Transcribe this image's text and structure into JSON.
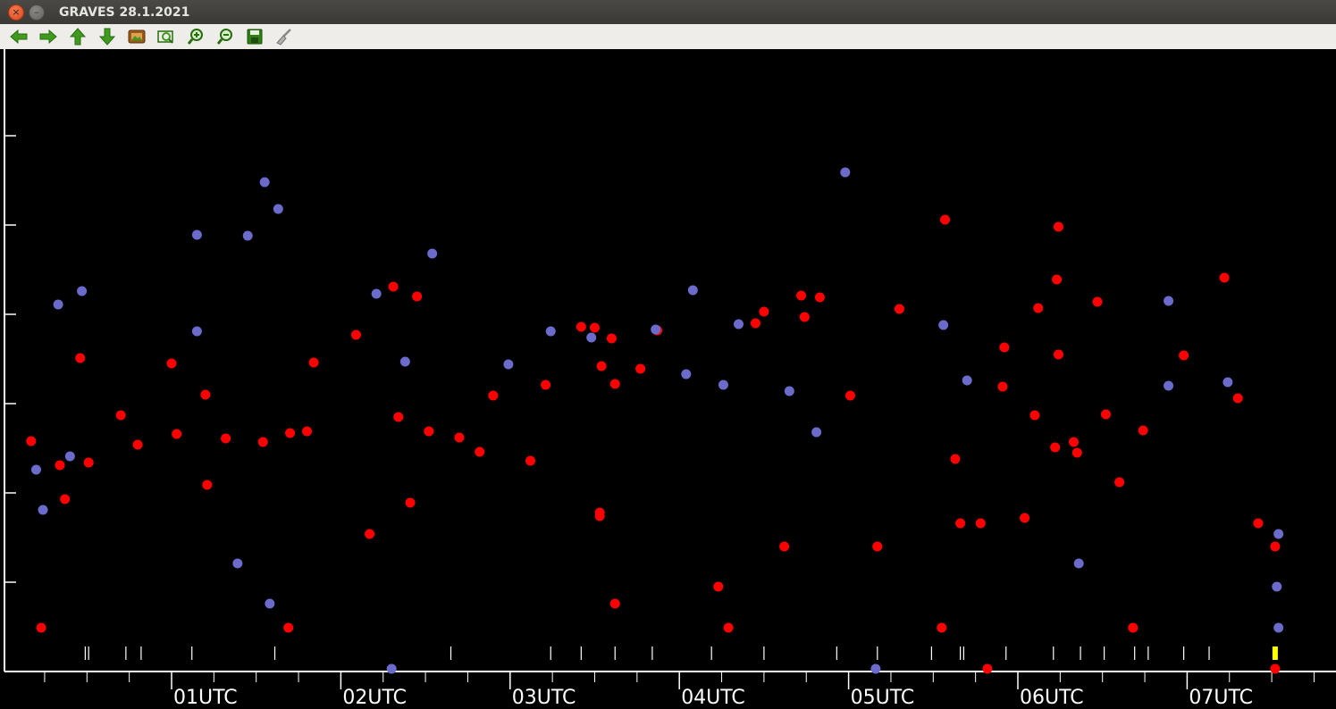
{
  "window": {
    "title": "GRAVES 28.1.2021"
  },
  "toolbar": {
    "items": [
      {
        "name": "back-arrow-icon",
        "kind": "arrow-left"
      },
      {
        "name": "forward-arrow-icon",
        "kind": "arrow-right"
      },
      {
        "name": "up-arrow-icon",
        "kind": "arrow-up"
      },
      {
        "name": "down-arrow-icon",
        "kind": "arrow-down"
      },
      {
        "name": "image-icon",
        "kind": "image"
      },
      {
        "name": "zoom-fit-icon",
        "kind": "zoom-fit"
      },
      {
        "name": "zoom-in-icon",
        "kind": "zoom-in"
      },
      {
        "name": "zoom-out-icon",
        "kind": "zoom-out"
      },
      {
        "name": "save-icon",
        "kind": "save"
      },
      {
        "name": "clear-brush-icon",
        "kind": "brush"
      }
    ]
  },
  "colors": {
    "red_series": "#ff0000",
    "blue_series": "#6b6bcc",
    "marker_highlight": "#ffff00",
    "axis": "#ffffff"
  },
  "chart_data": {
    "type": "scatter",
    "xlabel": "",
    "ylabel": "",
    "x_unit": "hour UTC",
    "xlim": [
      -0.98,
      7.83
    ],
    "ylim": [
      0,
      7
    ],
    "x_ticks": [
      {
        "x": 0,
        "label": "01UTC"
      },
      {
        "x": 1,
        "label": "02UTC"
      },
      {
        "x": 2,
        "label": "03UTC"
      },
      {
        "x": 3,
        "label": "04UTC"
      },
      {
        "x": 4,
        "label": "05UTC"
      },
      {
        "x": 5,
        "label": "06UTC"
      },
      {
        "x": 6,
        "label": "07UTC"
      }
    ],
    "minor_x_ticks": [
      -0.75,
      -0.5,
      -0.25,
      0.25,
      0.5,
      0.75,
      1.25,
      1.5,
      1.75,
      2.25,
      2.5,
      2.75,
      3.25,
      3.5,
      3.75,
      4.25,
      4.5,
      4.75,
      5.25,
      5.5,
      5.75,
      6.25,
      6.5,
      6.75
    ],
    "y_ticks": [
      1,
      2,
      3,
      4,
      5,
      6
    ],
    "event_marks": [
      -0.51,
      -0.49,
      -0.27,
      -0.18,
      0.12,
      0.61,
      1.65,
      2.24,
      2.42,
      2.62,
      2.84,
      3.19,
      3.5,
      3.93,
      4.17,
      4.49,
      4.66,
      4.68,
      4.93,
      5.21,
      5.37,
      5.51,
      5.69,
      5.77,
      5.98,
      6.13
    ],
    "highlight_mark": 6.52,
    "series": [
      {
        "name": "",
        "color": "#ff0000",
        "points": [
          [
            -0.83,
            2.58
          ],
          [
            -0.77,
            0.49
          ],
          [
            -0.66,
            2.31
          ],
          [
            -0.63,
            1.93
          ],
          [
            -0.54,
            3.51
          ],
          [
            -0.49,
            2.34
          ],
          [
            -0.3,
            2.87
          ],
          [
            -0.2,
            2.54
          ],
          [
            0.0,
            3.45
          ],
          [
            0.03,
            2.66
          ],
          [
            0.2,
            3.1
          ],
          [
            0.21,
            2.09
          ],
          [
            0.32,
            2.61
          ],
          [
            0.54,
            2.57
          ],
          [
            0.7,
            2.67
          ],
          [
            0.69,
            0.49
          ],
          [
            0.8,
            2.69
          ],
          [
            0.84,
            3.46
          ],
          [
            1.09,
            3.77
          ],
          [
            1.17,
            1.54
          ],
          [
            1.31,
            4.31
          ],
          [
            1.34,
            2.85
          ],
          [
            1.41,
            1.89
          ],
          [
            1.45,
            4.2
          ],
          [
            1.52,
            2.69
          ],
          [
            1.7,
            2.62
          ],
          [
            1.82,
            2.46
          ],
          [
            1.9,
            3.09
          ],
          [
            2.12,
            2.36
          ],
          [
            2.21,
            3.21
          ],
          [
            2.42,
            3.86
          ],
          [
            2.5,
            3.85
          ],
          [
            2.53,
            1.74
          ],
          [
            2.53,
            1.78
          ],
          [
            2.54,
            3.42
          ],
          [
            2.6,
            3.73
          ],
          [
            2.62,
            3.22
          ],
          [
            2.62,
            0.76
          ],
          [
            2.77,
            3.39
          ],
          [
            2.87,
            3.82
          ],
          [
            3.23,
            0.95
          ],
          [
            3.29,
            0.49
          ],
          [
            3.45,
            3.9
          ],
          [
            3.5,
            4.03
          ],
          [
            3.62,
            1.4
          ],
          [
            3.72,
            4.21
          ],
          [
            3.74,
            3.97
          ],
          [
            3.83,
            4.19
          ],
          [
            4.01,
            3.09
          ],
          [
            4.17,
            1.4
          ],
          [
            4.3,
            4.06
          ],
          [
            4.55,
            0.49
          ],
          [
            4.57,
            5.06
          ],
          [
            4.63,
            2.38
          ],
          [
            4.66,
            1.66
          ],
          [
            4.78,
            1.66
          ],
          [
            4.82,
            0.03
          ],
          [
            4.92,
            3.63
          ],
          [
            4.91,
            3.19
          ],
          [
            5.04,
            1.72
          ],
          [
            5.1,
            2.87
          ],
          [
            5.12,
            4.07
          ],
          [
            5.22,
            2.51
          ],
          [
            5.23,
            4.39
          ],
          [
            5.24,
            3.55
          ],
          [
            5.24,
            4.98
          ],
          [
            5.33,
            2.57
          ],
          [
            5.35,
            2.45
          ],
          [
            5.47,
            4.14
          ],
          [
            5.52,
            2.88
          ],
          [
            5.6,
            2.12
          ],
          [
            5.68,
            0.49
          ],
          [
            5.74,
            2.7
          ],
          [
            5.98,
            3.54
          ],
          [
            6.22,
            4.41
          ],
          [
            6.3,
            3.06
          ],
          [
            6.42,
            1.66
          ],
          [
            6.52,
            1.4
          ],
          [
            6.52,
            0.03
          ]
        ]
      },
      {
        "name": "",
        "color": "#6b6bcc",
        "points": [
          [
            -0.8,
            2.26
          ],
          [
            -0.76,
            1.81
          ],
          [
            -0.67,
            4.11
          ],
          [
            -0.6,
            2.41
          ],
          [
            -0.53,
            4.26
          ],
          [
            0.15,
            4.89
          ],
          [
            0.15,
            3.81
          ],
          [
            0.39,
            1.21
          ],
          [
            0.45,
            4.88
          ],
          [
            0.55,
            5.48
          ],
          [
            0.58,
            0.76
          ],
          [
            0.63,
            5.18
          ],
          [
            1.21,
            4.23
          ],
          [
            1.3,
            0.03
          ],
          [
            1.38,
            3.47
          ],
          [
            1.54,
            4.68
          ],
          [
            1.99,
            3.44
          ],
          [
            2.24,
            3.81
          ],
          [
            2.48,
            3.74
          ],
          [
            2.86,
            3.83
          ],
          [
            3.04,
            3.33
          ],
          [
            3.08,
            4.27
          ],
          [
            3.26,
            3.21
          ],
          [
            3.35,
            3.89
          ],
          [
            3.65,
            3.14
          ],
          [
            3.81,
            2.68
          ],
          [
            3.98,
            5.59
          ],
          [
            4.16,
            0.03
          ],
          [
            4.56,
            3.88
          ],
          [
            4.7,
            3.26
          ],
          [
            5.36,
            1.21
          ],
          [
            5.89,
            4.15
          ],
          [
            5.89,
            3.2
          ],
          [
            6.24,
            3.24
          ],
          [
            6.54,
            1.54
          ],
          [
            6.53,
            0.95
          ],
          [
            6.54,
            0.49
          ]
        ]
      }
    ]
  }
}
